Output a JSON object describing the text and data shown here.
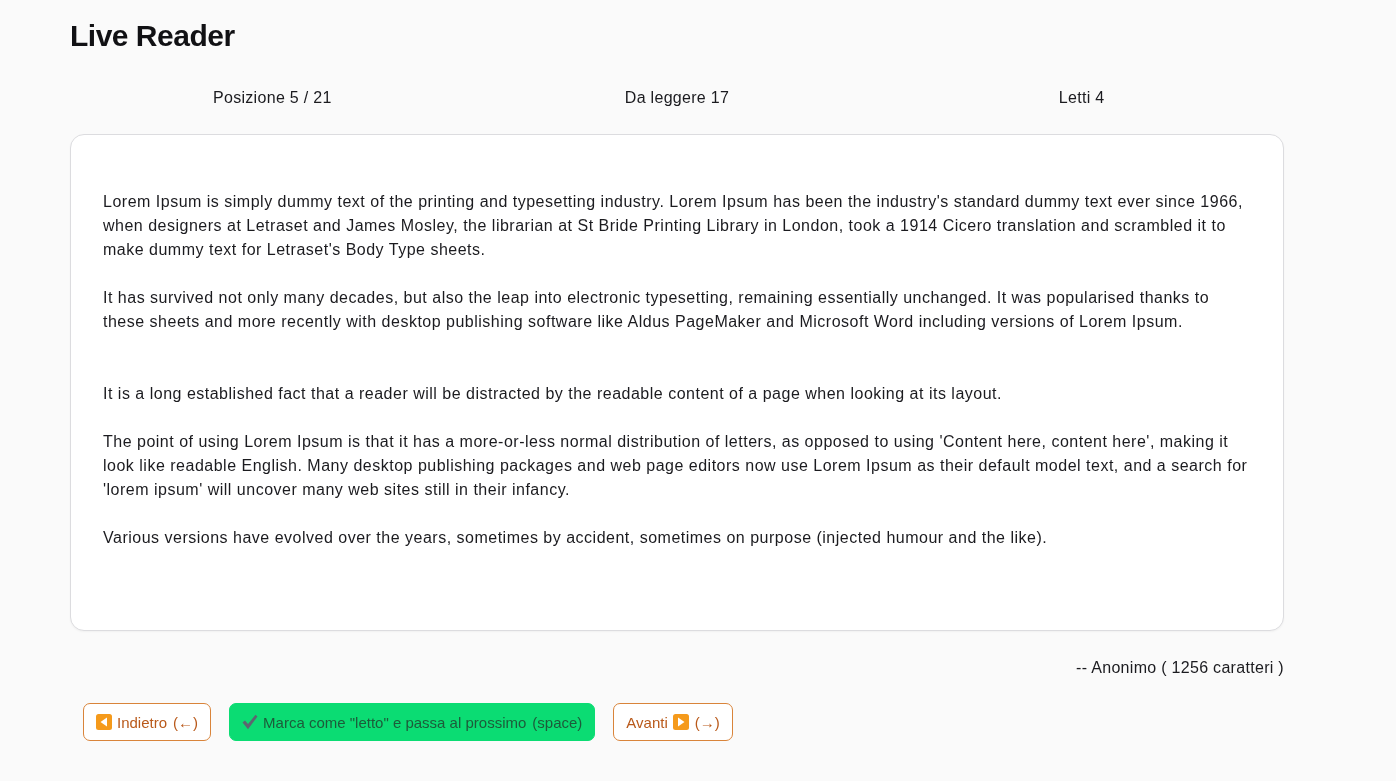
{
  "title": "Live Reader",
  "stats": [
    "Posizione 5 / 21",
    "Da leggere 17",
    "Letti 4"
  ],
  "passage": {
    "text": "Lorem Ipsum is simply dummy text of the printing and typesetting industry. Lorem Ipsum has been the industry's standard dummy text ever since 1966, when designers at Letraset and James Mosley, the librarian at St Bride Printing Library in London, took a 1914 Cicero translation and scrambled it to make dummy text for Letraset's Body Type sheets.\n\nIt has survived not only many decades, but also the leap into electronic typesetting, remaining essentially unchanged. It was popularised thanks to these sheets and more recently with desktop publishing software like Aldus PageMaker and Microsoft Word including versions of Lorem Ipsum.\n\n\nIt is a long established fact that a reader will be distracted by the readable content of a page when looking at its layout.\n\nThe point of using Lorem Ipsum is that it has a more-or-less normal distribution of letters, as opposed to using 'Content here, content here', making it look like readable English. Many desktop publishing packages and web page editors now use Lorem Ipsum as their default model text, and a search for 'lorem ipsum' will uncover many web sites still in their infancy.\n\nVarious versions have evolved over the years, sometimes by accident, sometimes on purpose (injected humour and the like).",
    "attribution": "-- Anonimo ( 1256 caratteri )"
  },
  "buttons": [
    {
      "kind": "back",
      "label": "Indietro",
      "shortcut": "(←)"
    },
    {
      "kind": "mark",
      "label": "Marca come \"letto\" e passa al prossimo",
      "shortcut": "(space)"
    },
    {
      "kind": "forward",
      "label": "Avanti",
      "shortcut": "(→)"
    }
  ]
}
